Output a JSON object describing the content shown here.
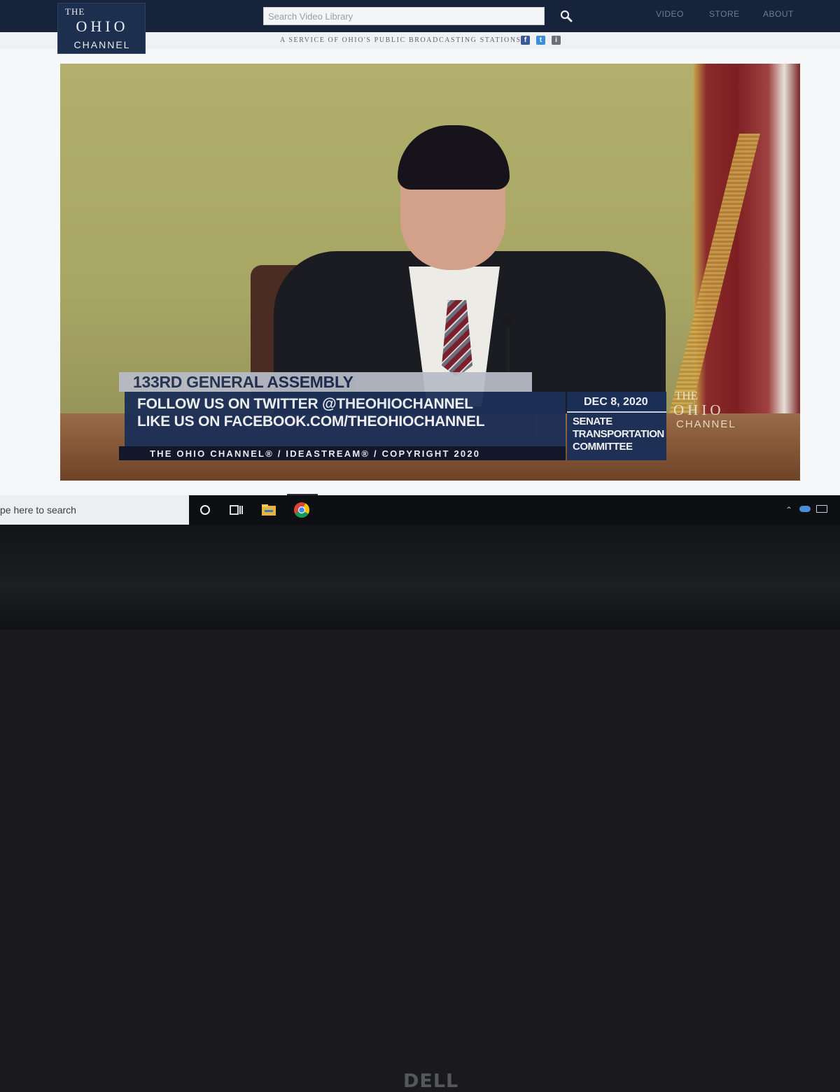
{
  "header": {
    "logo": {
      "line1": "THE",
      "line2": "OHIO",
      "line3": "CHANNEL"
    },
    "search": {
      "placeholder": "Search Video Library",
      "icon": "search-icon"
    },
    "nav": [
      "VIDEO",
      "STORE",
      "ABOUT"
    ],
    "tagline": "A SERVICE OF OHIO'S PUBLIC BROADCASTING STATIONS",
    "social": {
      "facebook": "f",
      "twitter": "t",
      "instagram": "i"
    }
  },
  "video": {
    "assembly": "133RD GENERAL ASSEMBLY",
    "follow_twitter": "FOLLOW US ON TWITTER @THEOHIOCHANNEL",
    "follow_facebook": "LIKE US ON FACEBOOK.COM/THEOHIOCHANNEL",
    "copyright": "THE OHIO CHANNEL® / IDEASTREAM® / COPYRIGHT 2020",
    "date": "DEC 8, 2020",
    "committee": [
      "SENATE",
      "TRANSPORTATION",
      "COMMITTEE"
    ],
    "bug": {
      "line1": "THE",
      "line2": "OHIO",
      "line3": "CHANNEL"
    }
  },
  "taskbar": {
    "search_text": "pe here to search",
    "icons": [
      "cortana-icon",
      "task-view-icon",
      "file-explorer-icon",
      "chrome-icon"
    ],
    "tray": [
      "chevron-up-icon",
      "onedrive-icon",
      "battery-icon"
    ]
  },
  "device": {
    "brand": "DELL"
  }
}
